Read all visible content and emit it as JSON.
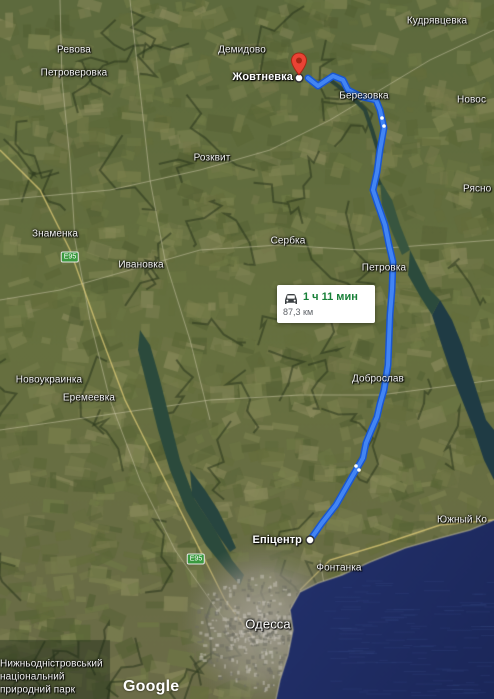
{
  "map": {
    "provider_logo": "Google",
    "route": {
      "duration": "1 ч 11 мин",
      "distance": "87,3 км",
      "mode_icon": "car-icon",
      "color": "#4285f4",
      "duration_color": "#188038"
    },
    "origin": "Епіцентр",
    "destination": "Жовтневка",
    "places": {
      "kudryavtseva": "Кудрявцевка",
      "revova": "Ревова",
      "demidovo": "Демидово",
      "petroverovka": "Петроверовка",
      "berezovka": "Березовка",
      "novos": "Новос",
      "rozkvit": "Розквит",
      "ryasno": "Рясно",
      "znamenka": "Знаменка",
      "serbka": "Сербка",
      "ivanovka": "Ивановка",
      "petrovka": "Петровка",
      "novoukrainka": "Новоукраинка",
      "dobroslav": "Доброслав",
      "eremeevka": "Еремеевка",
      "yuzhny": "Южный Ко",
      "fontanka": "Фонтанка",
      "odessa": "Одесса",
      "park_line1": "Нижньодністровський",
      "park_line2": "національний",
      "park_line3": "природний парк"
    },
    "highway_shields": [
      "E95",
      "E95"
    ]
  }
}
